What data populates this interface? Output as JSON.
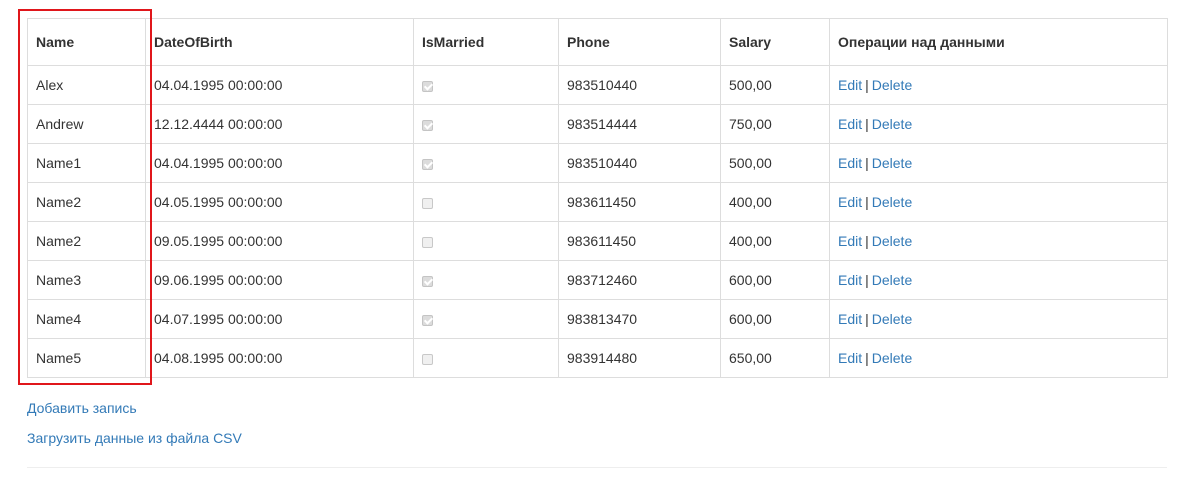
{
  "table": {
    "headers": {
      "name": "Name",
      "dob": "DateOfBirth",
      "married": "IsMarried",
      "phone": "Phone",
      "salary": "Salary",
      "ops": "Операции над данными"
    },
    "rows": [
      {
        "name": "Alex",
        "dob": "04.04.1995 00:00:00",
        "married": true,
        "phone": "983510440",
        "salary": "500,00"
      },
      {
        "name": "Andrew",
        "dob": "12.12.4444 00:00:00",
        "married": true,
        "phone": "983514444",
        "salary": "750,00"
      },
      {
        "name": "Name1",
        "dob": "04.04.1995 00:00:00",
        "married": true,
        "phone": "983510440",
        "salary": "500,00"
      },
      {
        "name": "Name2",
        "dob": "04.05.1995 00:00:00",
        "married": false,
        "phone": "983611450",
        "salary": "400,00"
      },
      {
        "name": "Name2",
        "dob": "09.05.1995 00:00:00",
        "married": false,
        "phone": "983611450",
        "salary": "400,00"
      },
      {
        "name": "Name3",
        "dob": "09.06.1995 00:00:00",
        "married": true,
        "phone": "983712460",
        "salary": "600,00"
      },
      {
        "name": "Name4",
        "dob": "04.07.1995 00:00:00",
        "married": true,
        "phone": "983813470",
        "salary": "600,00"
      },
      {
        "name": "Name5",
        "dob": "04.08.1995 00:00:00",
        "married": false,
        "phone": "983914480",
        "salary": "650,00"
      }
    ],
    "edit_label": "Edit",
    "separator": "|",
    "delete_label": "Delete"
  },
  "actions": {
    "add_record": "Добавить запись",
    "load_csv": "Загрузить данные из файла CSV"
  },
  "colors": {
    "link": "#337ab7",
    "highlight": "#e0161b",
    "border": "#dddddd"
  }
}
